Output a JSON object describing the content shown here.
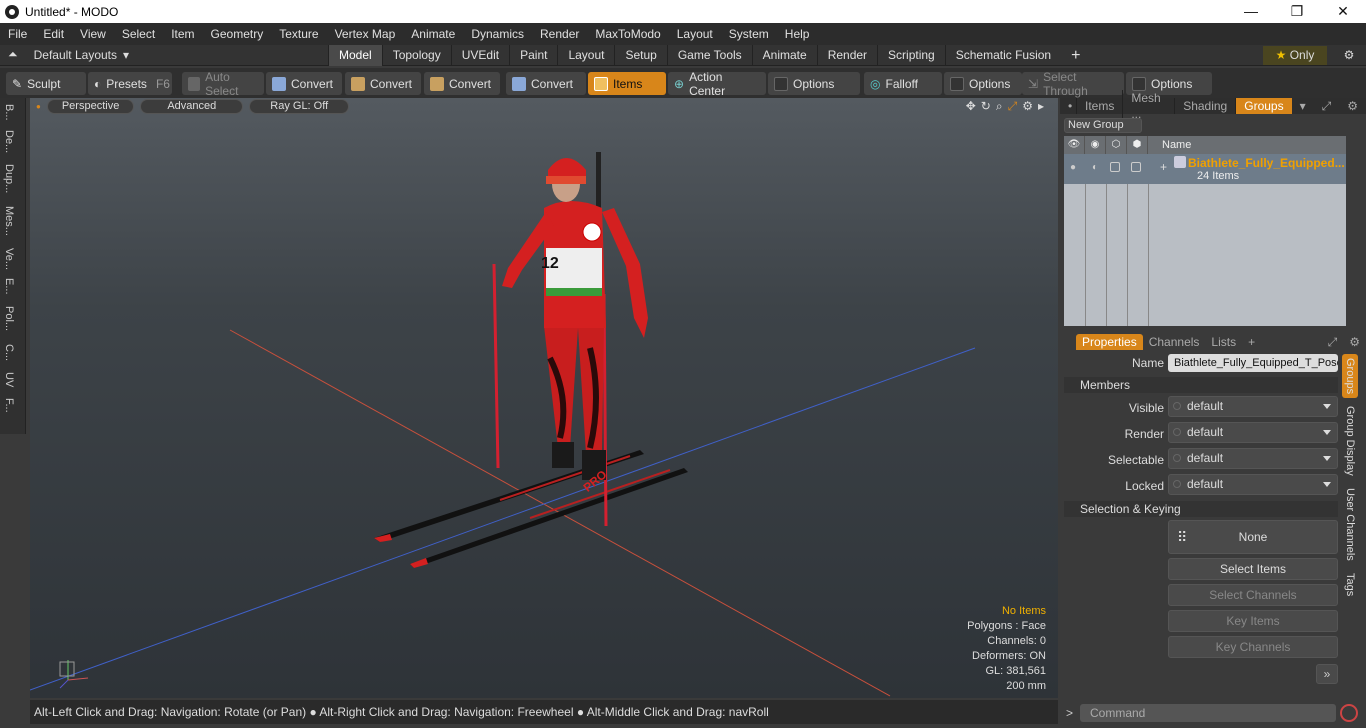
{
  "titlebar": {
    "title": "Untitled* - MODO",
    "min": "—",
    "max": "❐",
    "close": "✕"
  },
  "menu": [
    "File",
    "Edit",
    "View",
    "Select",
    "Item",
    "Geometry",
    "Texture",
    "Vertex Map",
    "Animate",
    "Dynamics",
    "Render",
    "MaxToModo",
    "Layout",
    "System",
    "Help"
  ],
  "layoutbar": {
    "layout_label": "Default Layouts",
    "tabs": [
      "Model",
      "Topology",
      "UVEdit",
      "Paint",
      "Layout",
      "Setup",
      "Game Tools",
      "Animate",
      "Render",
      "Scripting",
      "Schematic Fusion"
    ],
    "active_tab": "Model",
    "only_label": "Only"
  },
  "toolbar": {
    "sculpt": "Sculpt",
    "presets": "Presets",
    "presets_key": "F6",
    "auto_select": "Auto Select",
    "convert1": "Convert",
    "convert2": "Convert",
    "convert3": "Convert",
    "convert4": "Convert",
    "items": "Items",
    "action_center": "Action Center",
    "options1": "Options",
    "falloff": "Falloff",
    "options2": "Options",
    "select_through": "Select Through",
    "options3": "Options"
  },
  "left_tabs": [
    "B...",
    "De...",
    "Dup...",
    "Mes...",
    "Ve...",
    "E...",
    "Pol...",
    "C...",
    "UV",
    "F..."
  ],
  "viewport": {
    "perspective": "Perspective",
    "advanced": "Advanced",
    "raygl": "Ray GL: Off",
    "stats": {
      "no_items": "No Items",
      "polygons": "Polygons : Face",
      "channels": "Channels: 0",
      "deformers": "Deformers: ON",
      "gl": "GL: 381,561",
      "scale": "200 mm"
    },
    "bib_number": "12",
    "ski_text": "PRO"
  },
  "statusbar": {
    "hint": "Alt-Left Click and Drag: Navigation: Rotate (or Pan) ● Alt-Right Click and Drag: Navigation: Freewheel ● Alt-Middle Click and Drag: navRoll"
  },
  "rightpanel": {
    "tabs": [
      "Items",
      "Mesh ...",
      "Shading",
      "Groups"
    ],
    "active_tab": "Groups",
    "new_group": "New Group",
    "list_header_name": "Name",
    "group_name": "Biathlete_Fully_Equipped...",
    "group_count": "24 Items",
    "prop_tabs": [
      "Properties",
      "Channels",
      "Lists"
    ],
    "name_label": "Name",
    "name_value": "Biathlete_Fully_Equipped_T_Pose",
    "members_section": "Members",
    "visible_label": "Visible",
    "visible_value": "default",
    "render_label": "Render",
    "render_value": "default",
    "selectable_label": "Selectable",
    "selectable_value": "default",
    "locked_label": "Locked",
    "locked_value": "default",
    "sel_section": "Selection & Keying",
    "none_btn": "None",
    "select_items": "Select Items",
    "select_channels": "Select Channels",
    "key_items": "Key Items",
    "key_channels": "Key Channels",
    "side_tabs": [
      "Groups",
      "Group Display",
      "User Channels",
      "Tags"
    ],
    "command_placeholder": "Command"
  }
}
